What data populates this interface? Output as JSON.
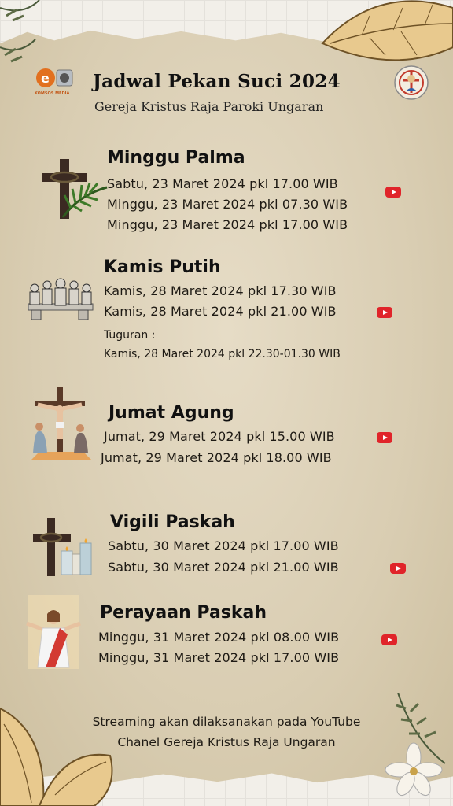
{
  "header": {
    "title": "Jadwal Pekan Suci 2024",
    "subtitle": "Gereja Kristus Raja Paroki Ungaran",
    "logo_left_text": "KOMSOS MEDIA",
    "logo_left_icon": "komsos-logo-icon",
    "logo_right_icon": "parish-emblem-icon"
  },
  "sections": [
    {
      "title": "Minggu Palma",
      "icon": "cross-palm-icon",
      "lines": [
        "Sabtu, 23 Maret 2024 pkl 17.00 WIB",
        "Minggu, 23 Maret 2024 pkl 07.30 WIB",
        "Minggu, 23 Maret 2024 pkl 17.00 WIB"
      ]
    },
    {
      "title": "Kamis Putih",
      "icon": "last-supper-icon",
      "lines": [
        "Kamis, 28 Maret 2024 pkl 17.30 WIB",
        "Kamis, 28 Maret 2024 pkl 21.00 WIB"
      ],
      "note_label": "Tuguran :",
      "note_line": "Kamis, 28 Maret 2024 pkl 22.30-01.30 WIB"
    },
    {
      "title": "Jumat Agung",
      "icon": "crucifixion-icon",
      "lines": [
        "Jumat, 29 Maret 2024 pkl 15.00 WIB",
        "Jumat, 29 Maret 2024 pkl 18.00 WIB"
      ]
    },
    {
      "title": "Vigili Paskah",
      "icon": "cross-candles-icon",
      "lines": [
        "Sabtu, 30 Maret 2024 pkl 17.00 WIB",
        "Sabtu, 30 Maret 2024 pkl 21.00 WIB"
      ]
    },
    {
      "title": "Perayaan Paskah",
      "icon": "risen-christ-icon",
      "lines": [
        "Minggu, 31 Maret 2024 pkl 08.00 WIB",
        "Minggu, 31 Maret 2024 pkl 17.00 WIB"
      ]
    }
  ],
  "footer": {
    "line1": "Streaming akan dilaksanakan pada YouTube",
    "line2": "Chanel Gereja Kristus Raja Ungaran"
  },
  "colors": {
    "paper": "#d9cdb2",
    "youtube_red": "#e0242a",
    "text": "#1e1a14"
  }
}
